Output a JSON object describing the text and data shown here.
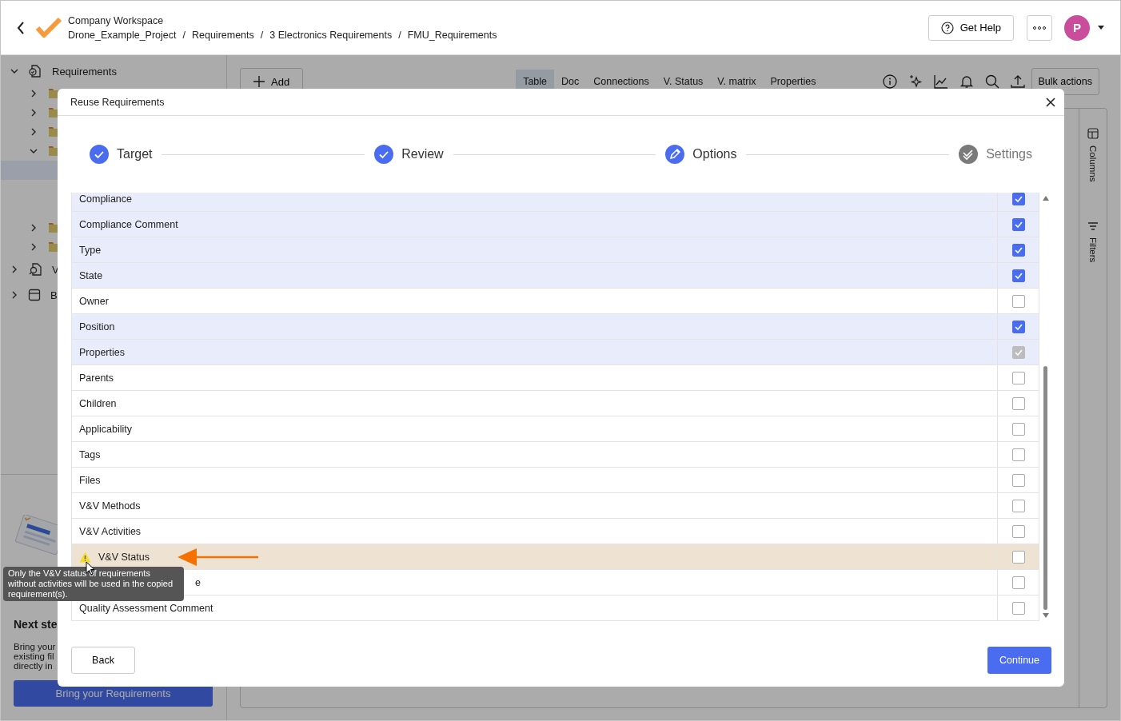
{
  "header": {
    "workspace": "Company Workspace",
    "breadcrumb": [
      "Drone_Example_Project",
      "Requirements",
      "3 Electronics Requirements",
      "FMU_Requirements"
    ],
    "separator": "/",
    "help_button": "Get Help",
    "avatar": "P"
  },
  "tree": [
    {
      "label": "Requirements",
      "kind": "requirements",
      "expanded": true,
      "children": [
        {
          "expanded": false
        },
        {
          "expanded": false
        },
        {
          "expanded": false
        },
        {
          "expanded": true,
          "children": [
            {
              "selected": true
            },
            {
              "selected": false
            },
            {
              "selected": false
            }
          ]
        },
        {
          "expanded": false
        },
        {
          "expanded": false
        }
      ]
    },
    {
      "label": "V",
      "kind": "verification",
      "expanded": false
    },
    {
      "label": "B",
      "kind": "box",
      "expanded": false
    }
  ],
  "next_steps": {
    "title": "Next ste",
    "text": "Bring your existing fil directly in",
    "button": "Bring your Requirements"
  },
  "toolbar": {
    "add_button": "Add",
    "tabs": [
      {
        "label": "Table",
        "selected": true
      },
      {
        "label": "Doc",
        "selected": false
      },
      {
        "label": "Connections",
        "selected": false
      },
      {
        "label": "V. Status",
        "selected": false
      },
      {
        "label": "V. matrix",
        "selected": false
      },
      {
        "label": "Properties",
        "selected": false
      }
    ],
    "bulk_button": "Bulk actions"
  },
  "side_panel": [
    "Columns",
    "Filters"
  ],
  "dialog": {
    "title": "Reuse Requirements",
    "steps": [
      {
        "label": "Target",
        "kind": "done"
      },
      {
        "label": "Review",
        "kind": "done"
      },
      {
        "label": "Options",
        "kind": "current"
      },
      {
        "label": "Settings",
        "kind": "pending"
      }
    ],
    "rows": [
      {
        "label": "Compliance",
        "kind": "field",
        "checked": true,
        "disabled": false
      },
      {
        "label": "Compliance Comment",
        "kind": "field",
        "checked": true,
        "disabled": false
      },
      {
        "label": "Type",
        "kind": "field",
        "checked": true,
        "disabled": false
      },
      {
        "label": "State",
        "kind": "field",
        "checked": true,
        "disabled": false
      },
      {
        "label": "Owner",
        "kind": "field",
        "checked": false,
        "disabled": false
      },
      {
        "label": "Position",
        "kind": "field",
        "checked": true,
        "disabled": false
      },
      {
        "label": "Properties",
        "kind": "field",
        "checked": true,
        "disabled": true
      },
      {
        "label": "Parents",
        "kind": "field",
        "checked": false,
        "disabled": false
      },
      {
        "label": "Children",
        "kind": "field",
        "checked": false,
        "disabled": false
      },
      {
        "label": "Applicability",
        "kind": "field",
        "checked": false,
        "disabled": false
      },
      {
        "label": "Tags",
        "kind": "field",
        "checked": false,
        "disabled": false
      },
      {
        "label": "Files",
        "kind": "field",
        "checked": false,
        "disabled": false
      },
      {
        "label": "V&V Methods",
        "kind": "field",
        "checked": false,
        "disabled": false
      },
      {
        "label": "V&V Activities",
        "kind": "field",
        "checked": false,
        "disabled": false
      },
      {
        "label": "V&V Status",
        "kind": "warning",
        "checked": false,
        "disabled": false
      },
      {
        "label": "e",
        "kind": "covered",
        "checked": false,
        "disabled": false
      },
      {
        "label": "Quality Assessment Comment",
        "kind": "field",
        "checked": false,
        "disabled": false
      }
    ],
    "tooltip": "Only the V&V status of requirements without activities will be used in the copied requirement(s).",
    "back_button": "Back",
    "continue_button": "Continue"
  }
}
